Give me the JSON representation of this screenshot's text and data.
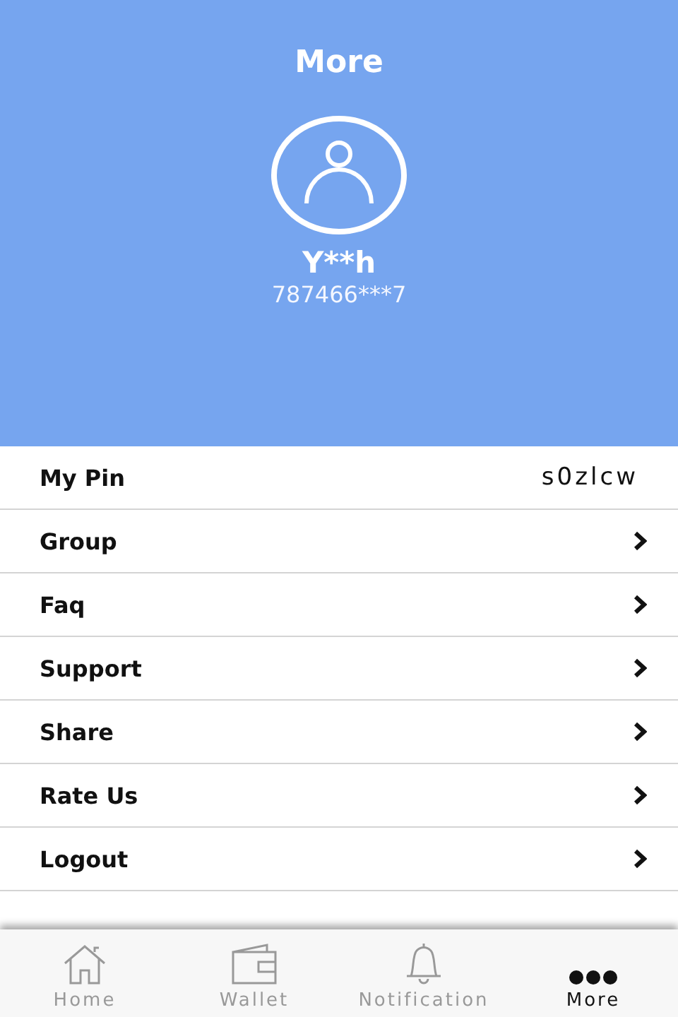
{
  "header": {
    "title": "More",
    "user_name": "Y**h",
    "phone": "787466***7"
  },
  "menu": [
    {
      "kind": "value",
      "label": "My Pin",
      "value": "s0zlcw"
    },
    {
      "kind": "link",
      "label": "Group"
    },
    {
      "kind": "link",
      "label": "Faq"
    },
    {
      "kind": "link",
      "label": "Support"
    },
    {
      "kind": "link",
      "label": "Share"
    },
    {
      "kind": "link",
      "label": "Rate Us"
    },
    {
      "kind": "link",
      "label": "Logout"
    }
  ],
  "tab_bar": [
    {
      "kind": "home",
      "label": "Home",
      "selected": false
    },
    {
      "kind": "wallet",
      "label": "Wallet",
      "selected": false
    },
    {
      "kind": "bell",
      "label": "Notification",
      "selected": false
    },
    {
      "kind": "dots",
      "label": "More",
      "selected": true
    }
  ]
}
